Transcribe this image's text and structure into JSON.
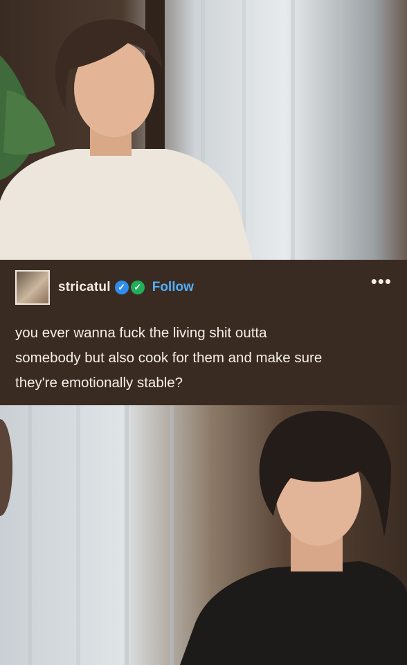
{
  "post": {
    "username": "stricatul",
    "follow_label": "Follow",
    "more_label": "•••",
    "badges": [
      "blue-check-badge-icon",
      "green-check-badge-icon"
    ],
    "text_lines": [
      "you ever wanna fuck the living shit outta",
      "somebody but also cook for them and make sure",
      "they're emotionally stable?"
    ]
  },
  "colors": {
    "post_background": "#3a2b22",
    "follow_link": "#52b0ff",
    "badge_blue": "#2f8cf0",
    "badge_green": "#21b05a"
  }
}
